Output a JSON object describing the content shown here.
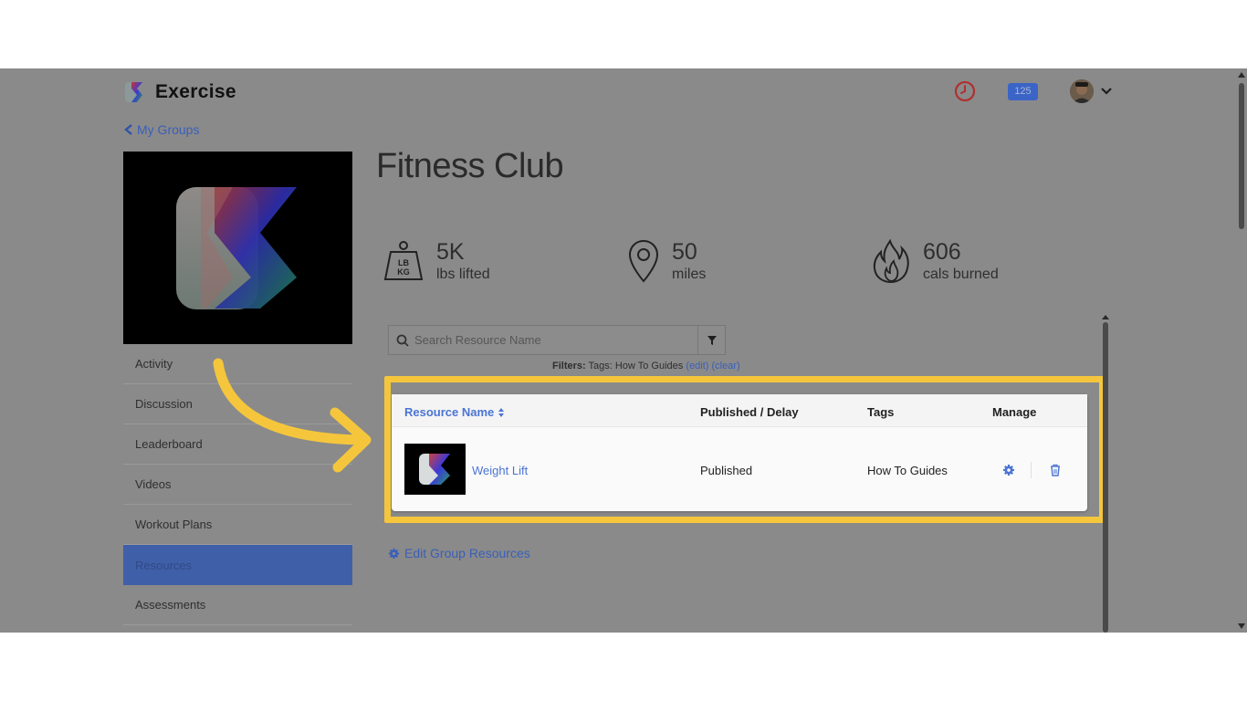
{
  "header": {
    "app_name": "Exercise",
    "notification_count": "125"
  },
  "nav": {
    "back_label": "My Groups"
  },
  "sidebar": {
    "items": [
      {
        "label": "Activity"
      },
      {
        "label": "Discussion"
      },
      {
        "label": "Leaderboard"
      },
      {
        "label": "Videos"
      },
      {
        "label": "Workout Plans"
      },
      {
        "label": "Resources",
        "active": true
      },
      {
        "label": "Assessments"
      }
    ]
  },
  "group": {
    "title": "Fitness Club"
  },
  "stats": [
    {
      "value": "5K",
      "label": "lbs lifted",
      "icon": "weight-icon"
    },
    {
      "value": "50",
      "label": "miles",
      "icon": "location-pin-icon"
    },
    {
      "value": "606",
      "label": "cals burned",
      "icon": "fire-icon"
    }
  ],
  "search": {
    "placeholder": "Search Resource Name"
  },
  "filters": {
    "prefix": "Filters:",
    "text": "Tags: How To Guides",
    "edit": "(edit)",
    "clear": "(clear)"
  },
  "table": {
    "columns": [
      "Resource Name",
      "Published / Delay",
      "Tags",
      "Manage"
    ],
    "rows": [
      {
        "name": "Weight Lift",
        "status": "Published",
        "tags": "How To Guides"
      }
    ]
  },
  "actions": {
    "edit_resources": "Edit Group Resources"
  },
  "colors": {
    "accent": "#4a74d4",
    "highlight": "#f5c63c",
    "overlay_bg": "#8a8a8a"
  }
}
